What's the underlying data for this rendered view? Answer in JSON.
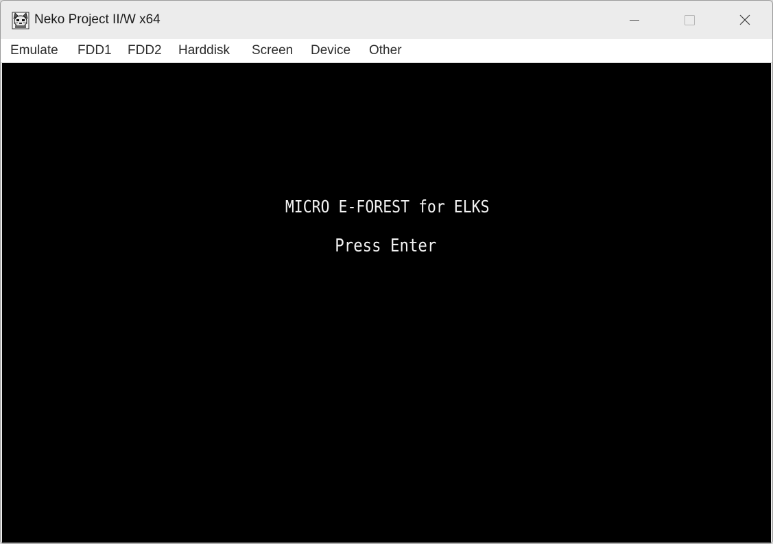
{
  "window": {
    "title": "Neko Project II/W x64",
    "icon": "neko-cat-icon"
  },
  "controls": {
    "minimize": "minimize-icon",
    "maximize": "maximize-icon",
    "close": "close-icon"
  },
  "menu": {
    "items": [
      "Emulate",
      "FDD1",
      "FDD2",
      "Harddisk",
      "Screen",
      "Device",
      "Other"
    ]
  },
  "screen": {
    "line1": "MICRO E-FOREST for ELKS",
    "line2": "Press Enter",
    "background": "#000000",
    "text_color": "#f2f2f2"
  }
}
